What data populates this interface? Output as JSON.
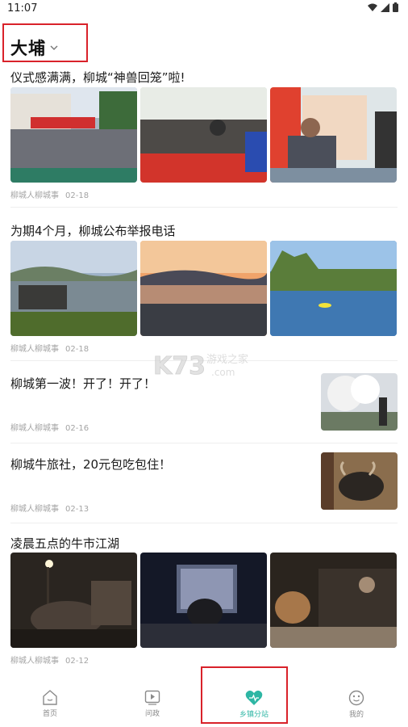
{
  "status": {
    "time": "11:07"
  },
  "header": {
    "location": "大埔"
  },
  "articles": [
    {
      "title": "仪式感满满，柳城“神兽回笼”啦!",
      "source": "柳城人柳城事",
      "date": "02-18"
    },
    {
      "title": "为期4个月，柳城公布举报电话",
      "source": "柳城人柳城事",
      "date": "02-18"
    },
    {
      "title": "柳城第一波！开了！开了！",
      "source": "柳城人柳城事",
      "date": "02-16"
    },
    {
      "title": "柳城牛旅社，20元包吃包住！",
      "source": "柳城人柳城事",
      "date": "02-13"
    },
    {
      "title": "凌晨五点的牛市江湖",
      "source": "柳城人柳城事",
      "date": "02-12"
    }
  ],
  "watermark": {
    "brand": "K73",
    "line1": "游戏之家",
    "line2": ".com"
  },
  "tabs": [
    {
      "label": "首页",
      "icon": "home-icon"
    },
    {
      "label": "问政",
      "icon": "play-icon"
    },
    {
      "label": "乡镇分站",
      "icon": "heart-icon"
    },
    {
      "label": "我的",
      "icon": "smile-icon"
    }
  ],
  "colors": {
    "accent": "#2db6a4",
    "highlight": "#d9222a",
    "meta": "#a4a4a4"
  }
}
